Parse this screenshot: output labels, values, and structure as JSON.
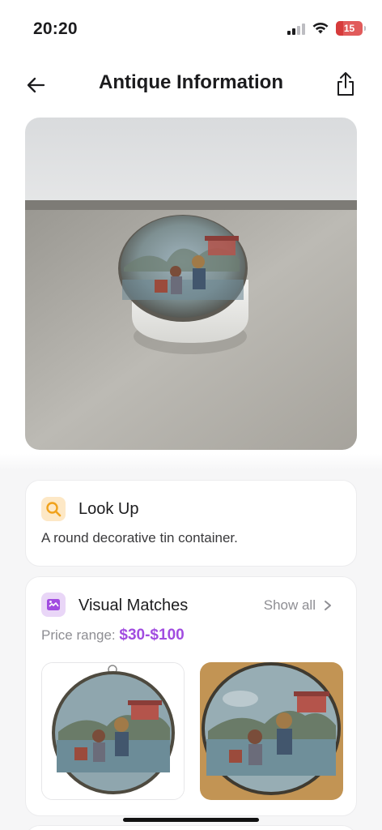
{
  "status_bar": {
    "time": "20:20",
    "battery": "15",
    "signal_strength": 2,
    "battery_color": "#e15b5b"
  },
  "nav": {
    "title": "Antique Information",
    "back_icon": "arrow-left-icon",
    "share_icon": "share-icon"
  },
  "lookup": {
    "title": "Look Up",
    "description": "A round decorative tin container.",
    "icon": "magnifier-icon",
    "icon_color": "#f0a21c"
  },
  "visual_matches": {
    "title": "Visual Matches",
    "show_all": "Show all",
    "price_label": "Price range:",
    "price_value": "$30-$100",
    "price_color": "#a14ce0",
    "icon": "image-match-icon"
  },
  "colors": {
    "accent_purple": "#a14ce0",
    "text_primary": "#1c1c1e",
    "text_secondary": "#8e8e93"
  }
}
